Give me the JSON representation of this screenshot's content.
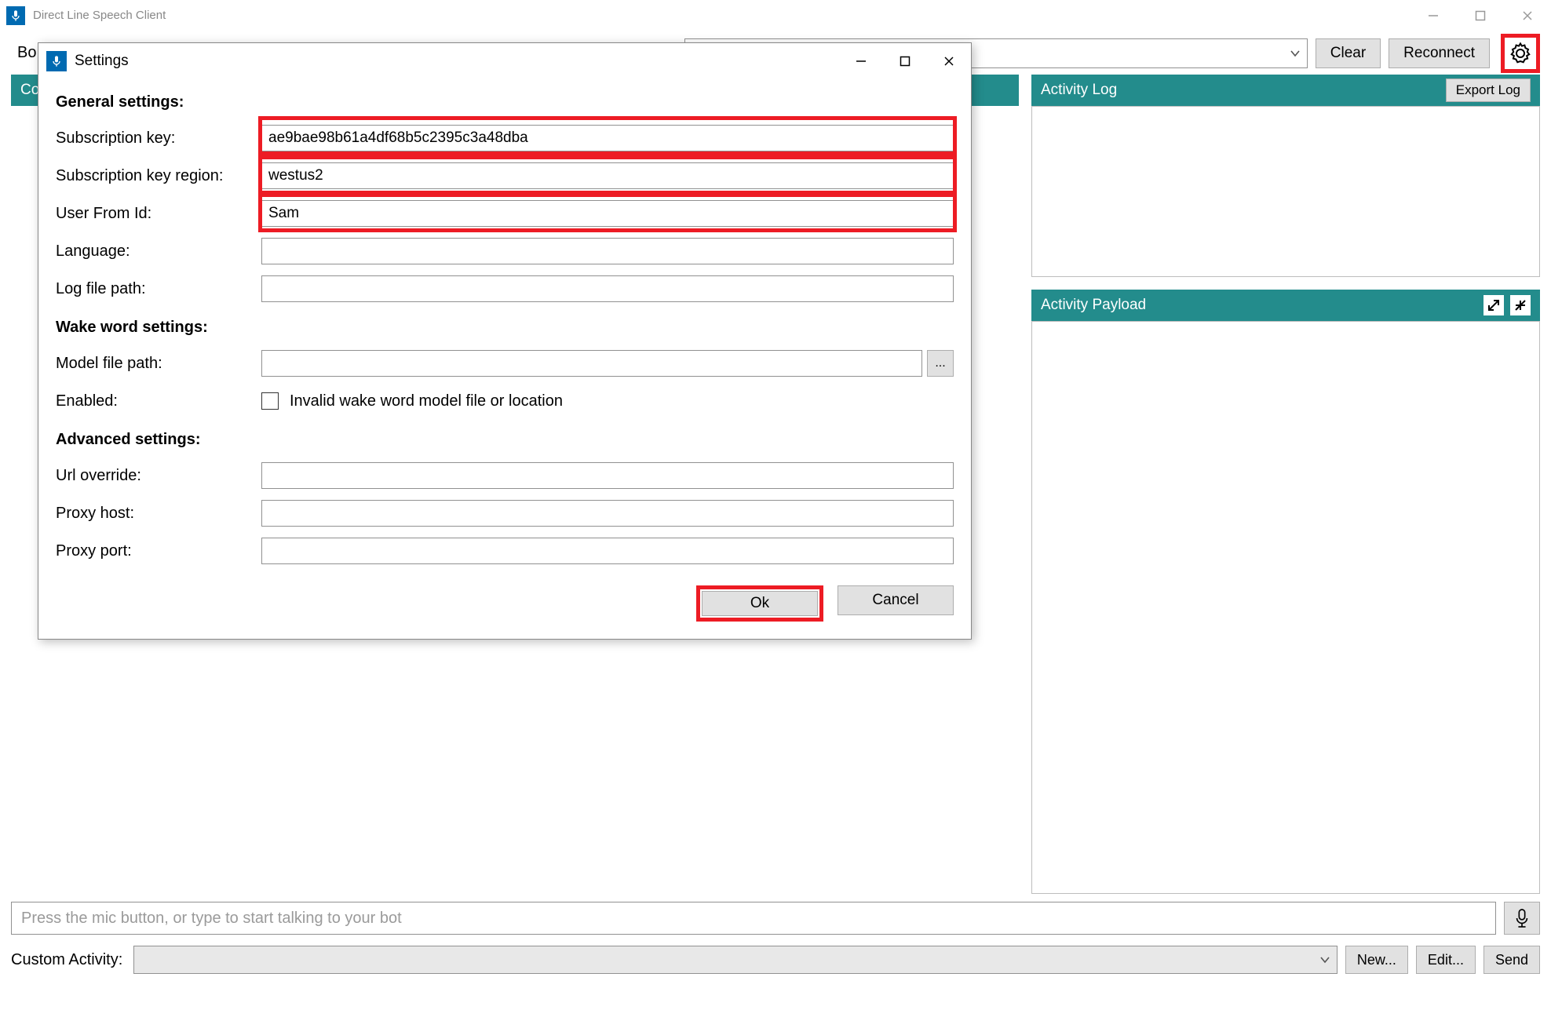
{
  "app": {
    "title": "Direct Line Speech Client"
  },
  "toolbar": {
    "bo_label": "Bo",
    "clear_label": "Clear",
    "reconnect_label": "Reconnect"
  },
  "panels": {
    "conversation_label": "Co",
    "activity_log_label": "Activity Log",
    "export_log_label": "Export Log",
    "activity_payload_label": "Activity Payload"
  },
  "bottom": {
    "message_placeholder": "Press the mic button, or type to start talking to your bot",
    "custom_activity_label": "Custom Activity:",
    "new_label": "New...",
    "edit_label": "Edit...",
    "send_label": "Send"
  },
  "settings": {
    "title": "Settings",
    "general": {
      "heading": "General settings:",
      "subscription_key_label": "Subscription key:",
      "subscription_key_value": "ae9bae98b61a4df68b5c2395c3a48dba",
      "region_label": "Subscription key region:",
      "region_value": "westus2",
      "user_from_id_label": "User From Id:",
      "user_from_id_value": "Sam",
      "language_label": "Language:",
      "language_value": "",
      "log_file_label": "Log file path:",
      "log_file_value": ""
    },
    "wake": {
      "heading": "Wake word settings:",
      "model_path_label": "Model file path:",
      "model_path_value": "",
      "enabled_label": "Enabled:",
      "enabled_text": "Invalid wake word model file or location"
    },
    "advanced": {
      "heading": "Advanced settings:",
      "url_override_label": "Url override:",
      "url_override_value": "",
      "proxy_host_label": "Proxy host:",
      "proxy_host_value": "",
      "proxy_port_label": "Proxy port:",
      "proxy_port_value": ""
    },
    "ok_label": "Ok",
    "cancel_label": "Cancel"
  }
}
